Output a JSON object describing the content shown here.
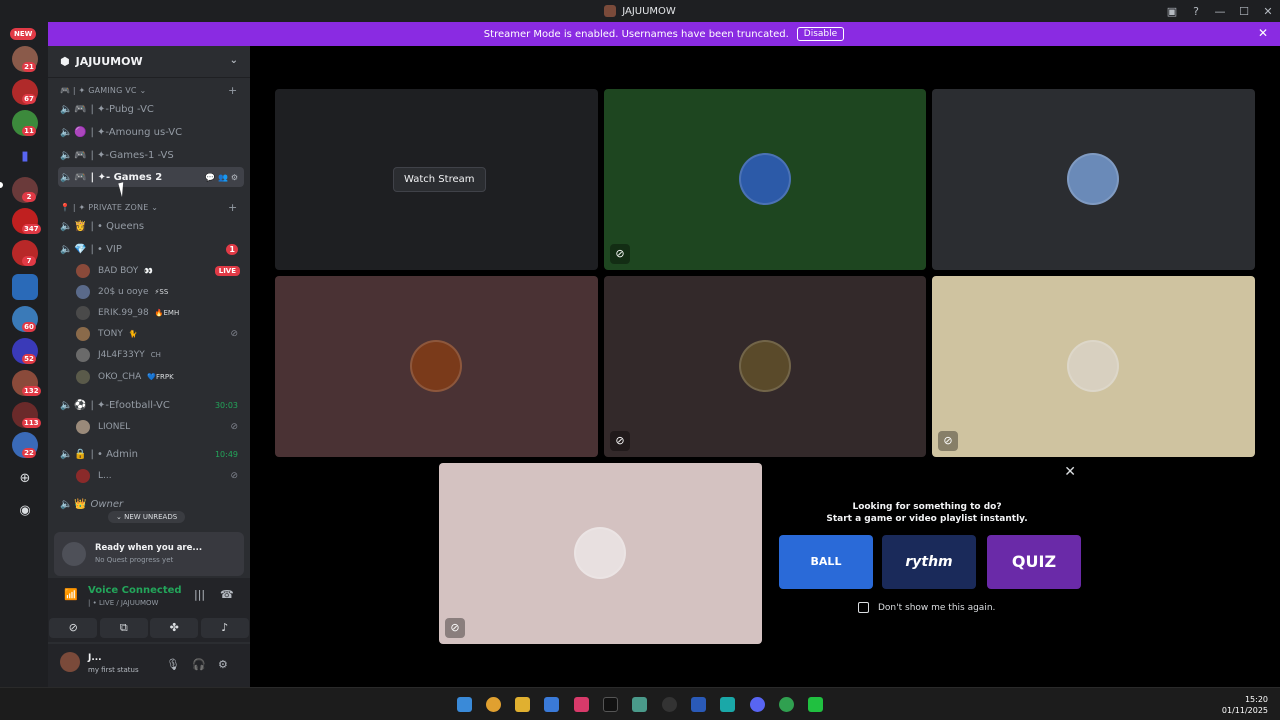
{
  "window": {
    "title": "JAJUUMOW"
  },
  "banner": {
    "text": "Streamer Mode is enabled. Usernames have been truncated.",
    "button": "Disable"
  },
  "guilds": {
    "new_label": "NEW",
    "badges": [
      "21",
      "67",
      "11",
      "2",
      "347",
      "7",
      "60",
      "52",
      "132",
      "113",
      "22"
    ]
  },
  "server": {
    "name": "JAJUUMOW",
    "categories": [
      {
        "label": "| ✦ GAMING VC ⌄"
      },
      {
        "label": "| ✦ PRIVATE ZONE ⌄"
      }
    ],
    "channels": [
      {
        "label": "| ✦-Pubg -VC"
      },
      {
        "label": "| ✦-Amoung us-VC"
      },
      {
        "label": "| ✦-Games-1 -VS"
      },
      {
        "label": "| ✦- Games 2"
      },
      {
        "label": "| • Queens"
      },
      {
        "label": "| • VIP",
        "badge": "1"
      },
      {
        "label": "| ✦-Efootball-VC",
        "time": "30:03"
      },
      {
        "label": "| • Admin",
        "time": "10:49"
      },
      {
        "label": "Owner"
      }
    ],
    "members_vip": [
      {
        "name": "BAD BOY",
        "tag": "👀",
        "live": "LIVE"
      },
      {
        "name": "20$ u ooye",
        "tag": "⚡SS"
      },
      {
        "name": "ERIK.99_98",
        "tag": "🔥EMH"
      },
      {
        "name": "TONY",
        "tag": "🐈"
      },
      {
        "name": "J4L4F33YY",
        "tag": "CH"
      },
      {
        "name": "OKO_CHA",
        "tag": "💙FRPK"
      }
    ],
    "members_efootball": [
      {
        "name": "LIONEL"
      }
    ],
    "members_admin": [
      {
        "name": "L..."
      }
    ],
    "new_unreads": "⌄ NEW UNREADS"
  },
  "quest": {
    "title": "Ready when you are...",
    "subtitle": "No Quest progress yet"
  },
  "voice": {
    "status": "Voice Connected",
    "channel": "| • LIVE / JAJUUMOW"
  },
  "user": {
    "name": "J...",
    "status": "my first status"
  },
  "stage": {
    "watch_stream": "Watch Stream"
  },
  "activity": {
    "line1": "Looking for something to do?",
    "line2": "Start a game or video playlist instantly.",
    "games": [
      "BALL",
      "rythm",
      "QUIZ"
    ],
    "dont_show": "Don't show me this again."
  },
  "taskbar": {
    "time": "15:20",
    "date": "01/11/2025"
  },
  "colors": {
    "accent_banner": "#8a2be2",
    "live_red": "#e13a46",
    "voice_green": "#23a55a",
    "tile_green": "#1e4620",
    "tile_beige": "#cfc3a0"
  }
}
